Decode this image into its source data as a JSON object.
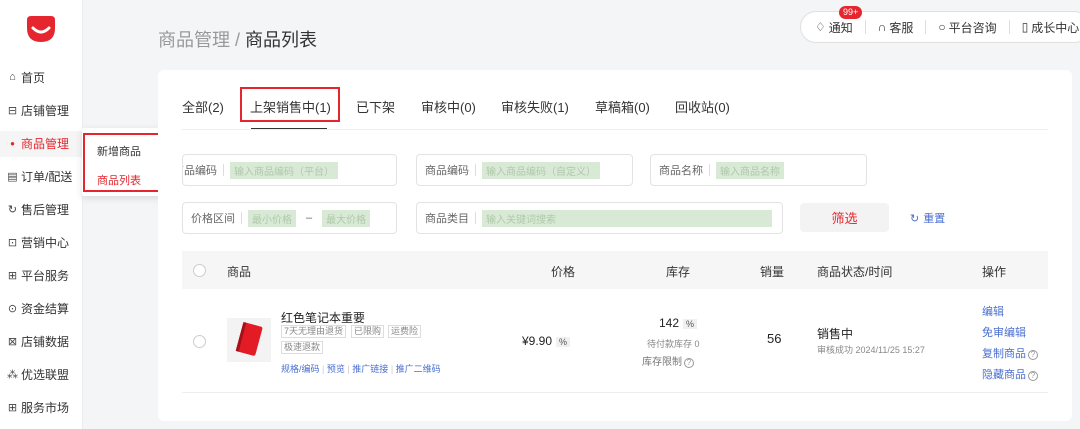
{
  "sidebar": {
    "items": [
      {
        "label": "首页",
        "icon": "home-icon",
        "glyph": "⌂"
      },
      {
        "label": "店铺管理",
        "icon": "store-icon",
        "glyph": "⊟"
      },
      {
        "label": "商品管理",
        "icon": "bag-icon",
        "glyph": "●"
      },
      {
        "label": "订单/配送",
        "icon": "order-icon",
        "glyph": "▤"
      },
      {
        "label": "售后管理",
        "icon": "aftersale-icon",
        "glyph": "↻"
      },
      {
        "label": "营销中心",
        "icon": "marketing-icon",
        "glyph": "⊡"
      },
      {
        "label": "平台服务",
        "icon": "platform-icon",
        "glyph": "⊞"
      },
      {
        "label": "资金结算",
        "icon": "settlement-icon",
        "glyph": "⊙"
      },
      {
        "label": "店铺数据",
        "icon": "data-icon",
        "glyph": "⊠"
      },
      {
        "label": "优选联盟",
        "icon": "alliance-icon",
        "glyph": "⁂"
      },
      {
        "label": "服务市场",
        "icon": "market-icon",
        "glyph": "⊞"
      }
    ],
    "submenu": [
      "新增商品",
      "商品列表"
    ]
  },
  "breadcrumb": {
    "parent": "商品管理",
    "sep": "/",
    "current": "商品列表"
  },
  "topbar": {
    "notice": "通知",
    "badge": "99+",
    "service": "客服",
    "consult": "平台咨询",
    "growth": "成长中心"
  },
  "tabs": [
    "全部(2)",
    "上架销售中(1)",
    "已下架",
    "审核中(0)",
    "审核失败(1)",
    "草稿箱(0)",
    "回收站(0)"
  ],
  "filters": {
    "code_platform": {
      "label": "商品编码",
      "placeholder": "输入商品编码（平台）"
    },
    "code_custom": {
      "label": "商品编码",
      "placeholder": "输入商品编码（自定义）"
    },
    "name": {
      "label": "商品名称",
      "placeholder": "输入商品名称"
    },
    "price": {
      "label": "价格区间",
      "min": "最小价格",
      "dash": "–",
      "max": "最大价格"
    },
    "category": {
      "label": "商品类目",
      "placeholder": "输入关键词搜索"
    },
    "filter_button": "筛选",
    "reset": "重置"
  },
  "table": {
    "headers": [
      "商品",
      "价格",
      "库存",
      "销量",
      "商品状态/时间",
      "操作"
    ],
    "rows": [
      {
        "title": "红色笔记本重要",
        "tags": [
          "7天无理由退货",
          "已限购",
          "运费险",
          "极速退款"
        ],
        "links": [
          "规格/编码",
          "|",
          "预览",
          "|",
          "推广链接",
          "|",
          "推广二维码"
        ],
        "price": "¥9.90",
        "stock": "142",
        "pending_stock": "待付款库存 0",
        "stock_limit": "库存限制",
        "sales": "56",
        "status": "销售中",
        "status_time": "审核成功 2024/11/25 15:27",
        "ops": [
          "编辑",
          "免审编辑",
          "复制商品",
          "隐藏商品"
        ]
      }
    ]
  },
  "colors": {
    "accent": "#e5262f",
    "link": "#4a6fd0"
  }
}
